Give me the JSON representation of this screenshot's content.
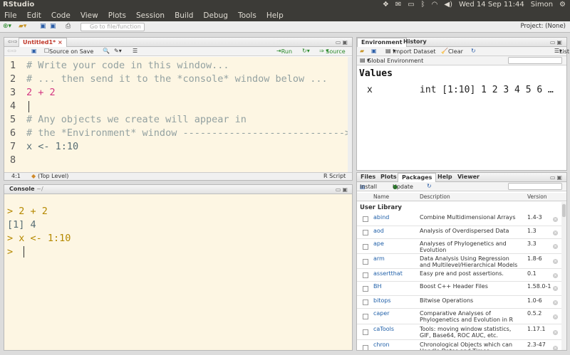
{
  "system": {
    "app_title": "RStudio",
    "datetime": "Wed 14 Sep 11:44",
    "user": "Simon"
  },
  "menu": [
    "File",
    "Edit",
    "Code",
    "View",
    "Plots",
    "Session",
    "Build",
    "Debug",
    "Tools",
    "Help"
  ],
  "toolbar": {
    "goto_placeholder": "Go to file/function",
    "project_label": "Project: (None)"
  },
  "source": {
    "tab_label": "Untitled1*",
    "source_on_save": "Source on Save",
    "run_label": "Run",
    "source_label": "Source",
    "lines": [
      {
        "n": "1",
        "text": "# Write your code in this window..."
      },
      {
        "n": "2",
        "text": "# ... then send it to the *console* window below ..."
      },
      {
        "n": "3",
        "text": "2 + 2"
      },
      {
        "n": "4",
        "text": ""
      },
      {
        "n": "5",
        "text": "# Any objects we create will appear in"
      },
      {
        "n": "6",
        "text": "# the *Environment* window ---------------------------->"
      },
      {
        "n": "7",
        "text": "x <- 1:10"
      },
      {
        "n": "8",
        "text": ""
      }
    ],
    "status_pos": "4:1",
    "status_scope": "(Top Level)",
    "status_type": "R Script"
  },
  "console": {
    "title": "Console",
    "path": "~/",
    "lines": [
      {
        "text": "> 2 + 2"
      },
      {
        "text": "[1] 4"
      },
      {
        "text": "> x <- 1:10"
      },
      {
        "text": "> "
      }
    ]
  },
  "environment": {
    "tabs": [
      "Environment",
      "History"
    ],
    "import_label": "Import Dataset",
    "clear_label": "Clear",
    "list_label": "List",
    "scope_label": "Global Environment",
    "section": "Values",
    "var_name": "x",
    "var_value": "int [1:10] 1 2 3 4 5 6 …"
  },
  "packages": {
    "tabs": [
      "Files",
      "Plots",
      "Packages",
      "Help",
      "Viewer"
    ],
    "install_label": "Install",
    "update_label": "Update",
    "col_name": "Name",
    "col_desc": "Description",
    "col_version": "Version",
    "user_library": "User Library",
    "rows": [
      {
        "name": "abind",
        "desc": "Combine Multidimensional Arrays",
        "version": "1.4-3"
      },
      {
        "name": "aod",
        "desc": "Analysis of Overdispersed Data",
        "version": "1.3"
      },
      {
        "name": "ape",
        "desc": "Analyses of Phylogenetics and Evolution",
        "version": "3.3"
      },
      {
        "name": "arm",
        "desc": "Data Analysis Using Regression and Multilevel/Hierarchical Models",
        "version": "1.8-6"
      },
      {
        "name": "assertthat",
        "desc": "Easy pre and post assertions.",
        "version": "0.1"
      },
      {
        "name": "BH",
        "desc": "Boost C++ Header Files",
        "version": "1.58.0-1"
      },
      {
        "name": "bitops",
        "desc": "Bitwise Operations",
        "version": "1.0-6"
      },
      {
        "name": "caper",
        "desc": "Comparative Analyses of Phylogenetics and Evolution in R",
        "version": "0.5.2"
      },
      {
        "name": "caTools",
        "desc": "Tools: moving window statistics, GIF, Base64, ROC AUC, etc.",
        "version": "1.17.1"
      },
      {
        "name": "chron",
        "desc": "Chronological Objects which can Handle Dates and Times",
        "version": "2.3-47"
      }
    ]
  }
}
